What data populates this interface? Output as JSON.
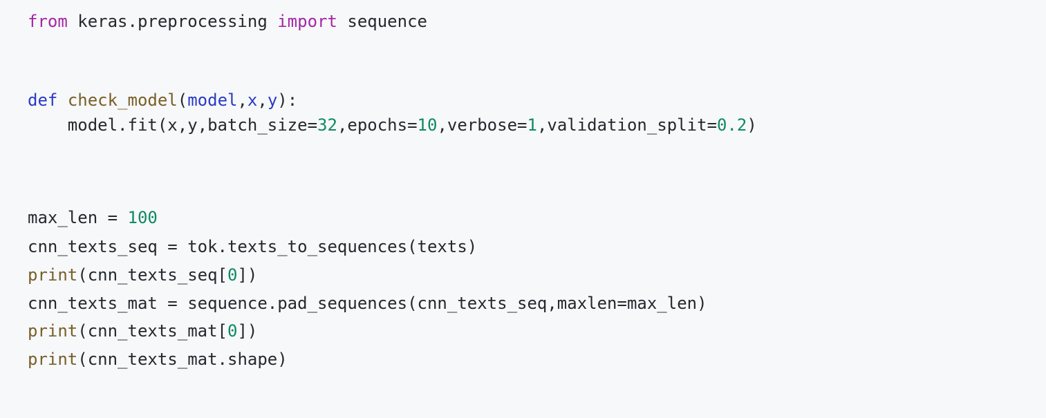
{
  "colors": {
    "background": "#f6f8fa",
    "plain": "#24292e",
    "keyword": "#a626a4",
    "def": "#2a39c4",
    "funcname": "#795e26",
    "param": "#2a39c4",
    "number": "#0f8a5f",
    "builtin": "#795e26"
  },
  "code": {
    "language": "python",
    "lines": [
      {
        "tokens": [
          {
            "type": "keyword",
            "text": "from"
          },
          {
            "type": "plain",
            "text": " keras.preprocessing "
          },
          {
            "type": "keyword",
            "text": "import"
          },
          {
            "type": "plain",
            "text": " sequence"
          }
        ]
      },
      {
        "tokens": []
      },
      {
        "tokens": [
          {
            "type": "def",
            "text": "def"
          },
          {
            "type": "plain",
            "text": " "
          },
          {
            "type": "funcname",
            "text": "check_model"
          },
          {
            "type": "plain",
            "text": "("
          },
          {
            "type": "param",
            "text": "model"
          },
          {
            "type": "plain",
            "text": ","
          },
          {
            "type": "param",
            "text": "x"
          },
          {
            "type": "plain",
            "text": ","
          },
          {
            "type": "param",
            "text": "y"
          },
          {
            "type": "plain",
            "text": "):"
          }
        ]
      },
      {
        "tokens": [
          {
            "type": "plain",
            "text": "    model.fit(x,y,batch_size="
          },
          {
            "type": "number",
            "text": "32"
          },
          {
            "type": "plain",
            "text": ",epochs="
          },
          {
            "type": "number",
            "text": "10"
          },
          {
            "type": "plain",
            "text": ",verbose="
          },
          {
            "type": "number",
            "text": "1"
          },
          {
            "type": "plain",
            "text": ",validation_split="
          },
          {
            "type": "number",
            "text": "0.2"
          },
          {
            "type": "plain",
            "text": ")"
          }
        ]
      },
      {
        "tokens": []
      },
      {
        "tokens": []
      },
      {
        "tokens": [
          {
            "type": "plain",
            "text": "max_len = "
          },
          {
            "type": "number",
            "text": "100"
          }
        ]
      },
      {
        "tokens": [
          {
            "type": "plain",
            "text": "cnn_texts_seq = tok.texts_to_sequences(texts)"
          }
        ]
      },
      {
        "tokens": [
          {
            "type": "builtin",
            "text": "print"
          },
          {
            "type": "plain",
            "text": "(cnn_texts_seq["
          },
          {
            "type": "number",
            "text": "0"
          },
          {
            "type": "plain",
            "text": "])"
          }
        ]
      },
      {
        "tokens": [
          {
            "type": "plain",
            "text": "cnn_texts_mat = sequence.pad_sequences(cnn_texts_seq,maxlen=max_len)"
          }
        ]
      },
      {
        "tokens": [
          {
            "type": "builtin",
            "text": "print"
          },
          {
            "type": "plain",
            "text": "(cnn_texts_mat["
          },
          {
            "type": "number",
            "text": "0"
          },
          {
            "type": "plain",
            "text": "])"
          }
        ]
      },
      {
        "tokens": [
          {
            "type": "builtin",
            "text": "print"
          },
          {
            "type": "plain",
            "text": "(cnn_texts_mat.shape)"
          }
        ]
      }
    ]
  }
}
